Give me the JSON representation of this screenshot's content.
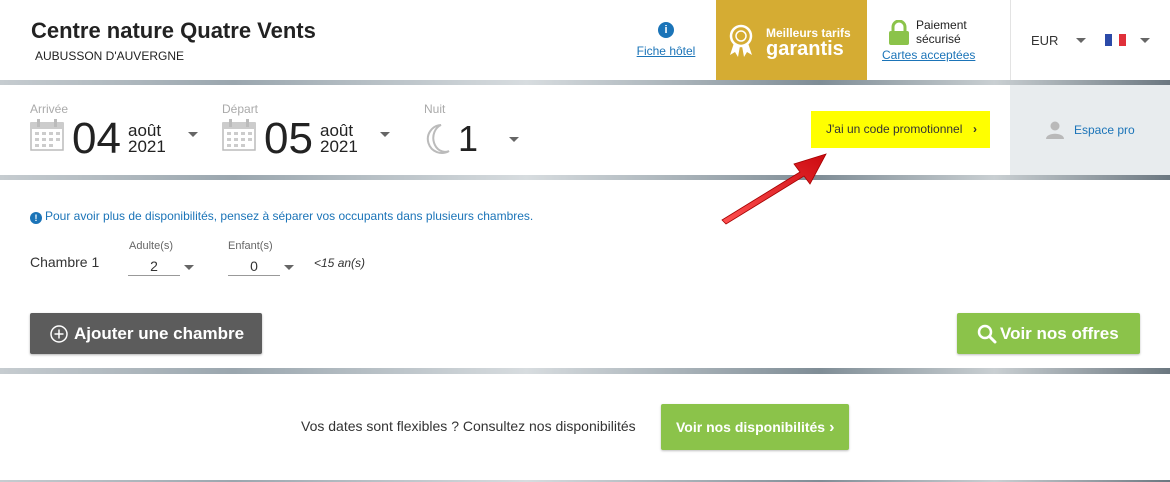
{
  "header": {
    "hotel_name": "Centre nature Quatre Vents",
    "hotel_city": "AUBUSSON D'AUVERGNE",
    "fiche_label": "Fiche hôtel",
    "best_rates_line1": "Meilleurs tarifs",
    "best_rates_line2": "garantis",
    "secure_line1": "Paiement sécurisé",
    "cards_link": "Cartes acceptées",
    "currency": "EUR",
    "language_flag": "fr-flag-icon"
  },
  "dates": {
    "arrival_label": "Arrivée",
    "arrival_day": "04",
    "arrival_month": "août",
    "arrival_year": "2021",
    "departure_label": "Départ",
    "departure_day": "05",
    "departure_month": "août",
    "departure_year": "2021",
    "nights_label": "Nuit",
    "nights_value": "1",
    "promo_label": "J'ai un code promotionnel",
    "espace_pro_label": "Espace pro"
  },
  "rooms": {
    "notice": "Pour avoir plus de disponibilités, pensez à séparer vos occupants dans plusieurs chambres.",
    "room_label": "Chambre 1",
    "adults_label": "Adulte(s)",
    "adults_value": "2",
    "children_label": "Enfant(s)",
    "children_value": "0",
    "children_age_note": "<15 an(s)",
    "add_room_button": "Ajouter une chambre",
    "view_offers_button": "Voir nos offres"
  },
  "flexible": {
    "text": "Vos dates sont flexibles ? Consultez nos disponibilités",
    "button": "Voir nos disponibilités"
  },
  "colors": {
    "accent_blue": "#1b74b8",
    "gold": "#d5ac33",
    "green": "#8bc34a",
    "promo_highlight": "#ffff00",
    "annotation_arrow": "#e0141b"
  }
}
